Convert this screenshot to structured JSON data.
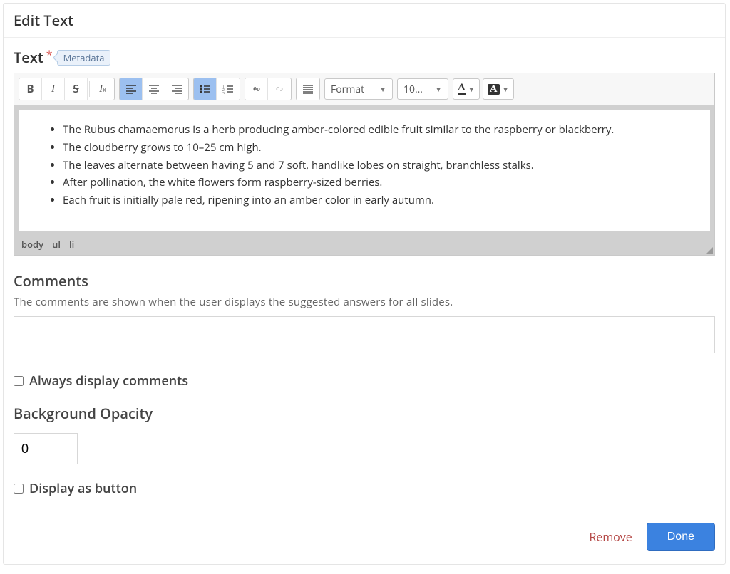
{
  "header": {
    "title": "Edit Text"
  },
  "text_field": {
    "label": "Text",
    "metadata_chip": "Metadata"
  },
  "toolbar": {
    "format_label": "Format",
    "size_label": "10…"
  },
  "editor": {
    "bullets": [
      "The Rubus chamaemorus is a herb producing amber-colored edible fruit similar to the raspberry or blackberry.",
      "The cloudberry grows to 10–25 cm high.",
      "The leaves alternate between having 5 and 7 soft, handlike lobes on straight, branchless stalks.",
      "After pollination, the white flowers form raspberry-sized berries.",
      "Each fruit is initially pale red, ripening into an amber color in early autumn."
    ],
    "path": [
      "body",
      "ul",
      "li"
    ]
  },
  "comments": {
    "label": "Comments",
    "help": "The comments are shown when the user displays the suggested answers for all slides.",
    "value": ""
  },
  "always_display": {
    "label": "Always display comments",
    "checked": false
  },
  "background_opacity": {
    "label": "Background Opacity",
    "value": "0"
  },
  "display_as_button": {
    "label": "Display as button",
    "checked": false
  },
  "footer": {
    "remove": "Remove",
    "done": "Done"
  }
}
